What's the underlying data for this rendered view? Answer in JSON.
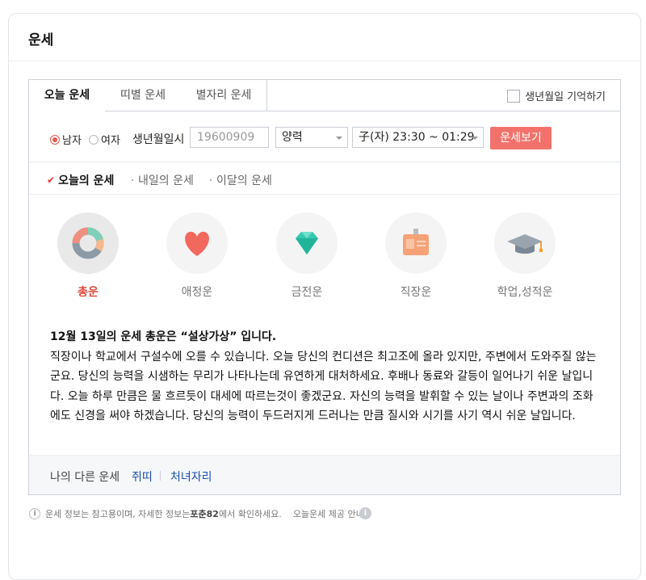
{
  "card": {
    "title": "운세"
  },
  "tabs": [
    {
      "label": "오늘 운세"
    },
    {
      "label": "띠별 운세"
    },
    {
      "label": "별자리 운세"
    }
  ],
  "remember_label": "생년월일 기억하기",
  "form": {
    "gender_male": "남자",
    "gender_female": "여자",
    "gender_selected": "남자",
    "dob_label": "생년월일시",
    "dob_placeholder": "19600909",
    "calendar_value": "양력",
    "time_value": "子(자) 23:30 ~ 01:29",
    "submit_label": "운세보기"
  },
  "subnav": [
    {
      "label": "오늘의 운세"
    },
    {
      "label": "내일의 운세"
    },
    {
      "label": "이달의 운세"
    }
  ],
  "categories": [
    {
      "label": "총운",
      "icon": "donut-chart-icon"
    },
    {
      "label": "애정운",
      "icon": "heart-icon"
    },
    {
      "label": "금전운",
      "icon": "diamond-icon"
    },
    {
      "label": "직장운",
      "icon": "id-badge-icon"
    },
    {
      "label": "학업,성적운",
      "icon": "graduation-cap-icon"
    }
  ],
  "fortune": {
    "headline": "12월 13일의 운세 총운은 “설상가상” 입니다.",
    "body": "직장이나 학교에서 구설수에 오를 수 있습니다. 오늘 당신의 컨디션은 최고조에 올라 있지만, 주변에서 도와주질 않는군요. 당신의 능력을 시샘하는 무리가 나타나는데 유연하게 대처하세요. 후배나 동료와 갈등이 일어나기 쉬운 날입니다. 오늘 하루 만큼은 물 흐르듯이 대세에 따르는것이 좋겠군요. 자신의 능력을 발휘할 수 있는 날이나 주변과의 조화에도 신경을 써야 하겠습니다. 당신의 능력이 두드러지게 드러나는 만큼 질시와 시기를 사기 역시 쉬운 날입니다."
  },
  "footer": {
    "label": "나의 다른 운세",
    "link1": "쥐띠",
    "link2": "처녀자리"
  },
  "notice": {
    "pre": "운세 정보는 참고용이며, 자세한 정보는 ",
    "brand": "포춘82",
    "post": " 에서 확인하세요.",
    "guide": "오늘운세 제공 안내"
  },
  "colors": {
    "accent": "#f2726b",
    "active_label": "#e34b3f",
    "link": "#1a4fa8"
  }
}
